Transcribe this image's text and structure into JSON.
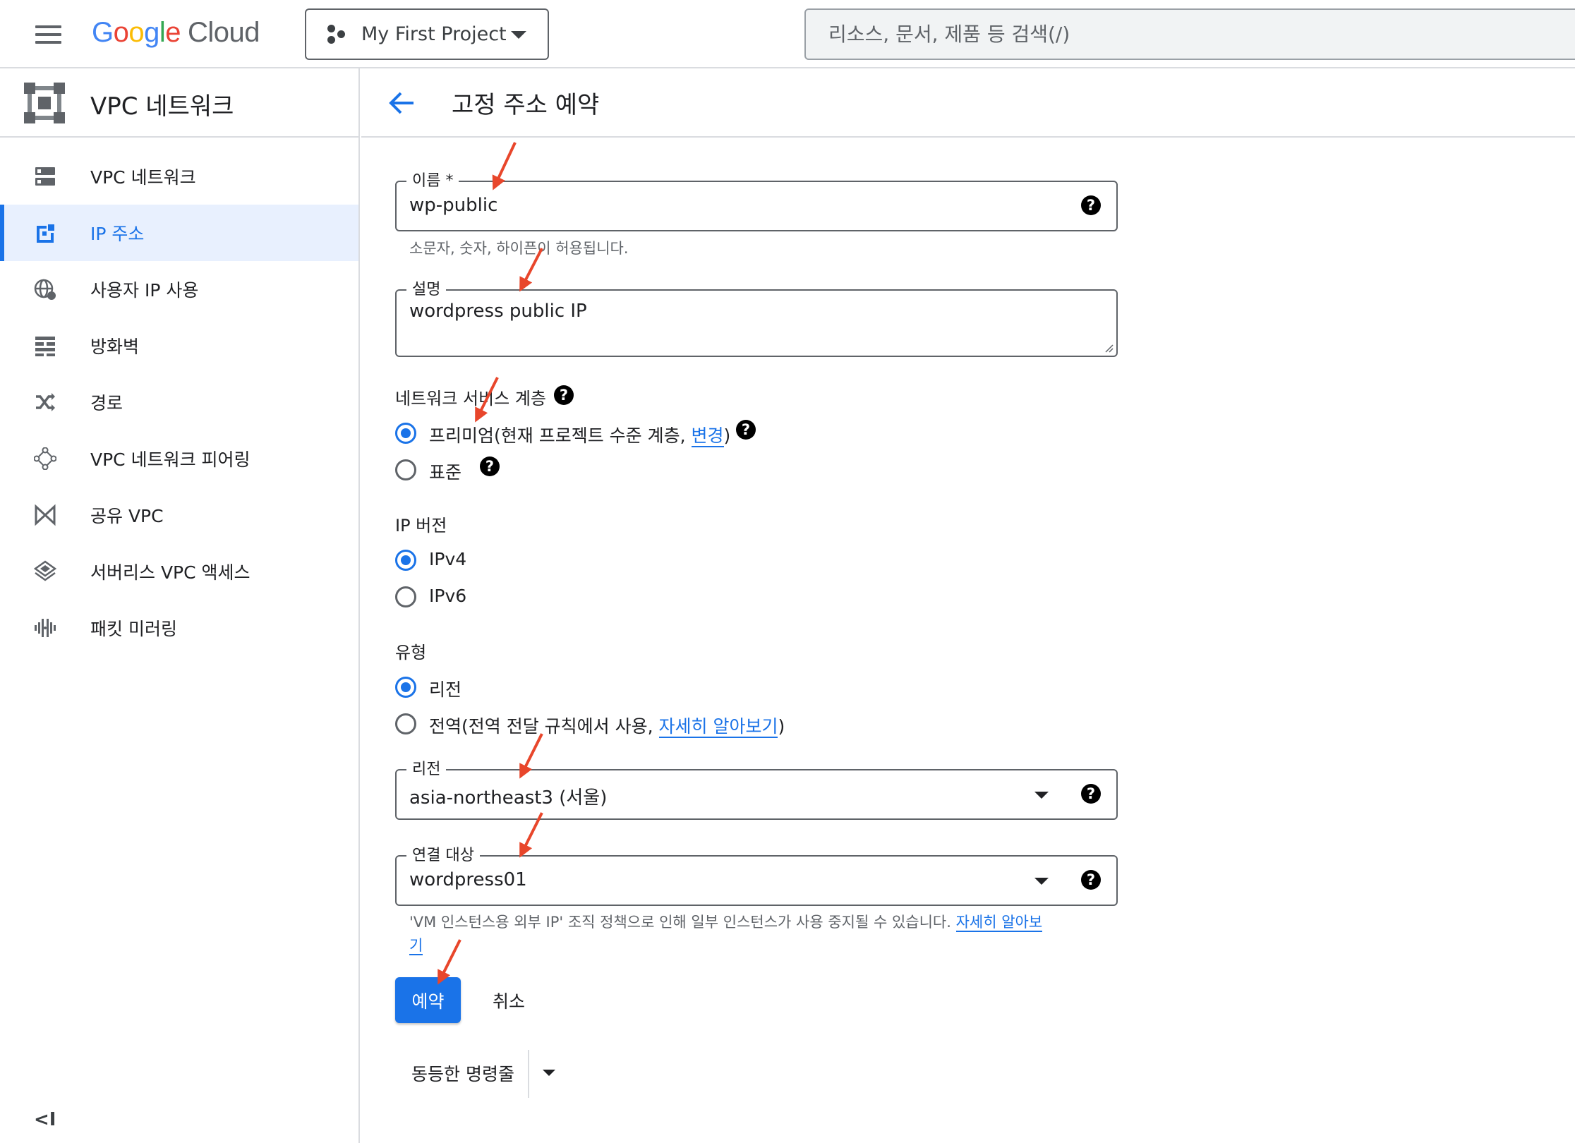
{
  "topbar": {
    "logo_letters": [
      "G",
      "o",
      "o",
      "g",
      "l",
      "e"
    ],
    "logo_cloud": "Cloud",
    "project": "My First Project",
    "search_placeholder": "리소스, 문서, 제품 등 검색(/)"
  },
  "sidebar": {
    "title": "VPC 네트워크",
    "items": [
      {
        "label": "VPC 네트워크",
        "icon": "vpc-networks-icon"
      },
      {
        "label": "IP 주소",
        "icon": "ip-address-icon",
        "active": true
      },
      {
        "label": "사용자 IP 사용",
        "icon": "globe-icon"
      },
      {
        "label": "방화벽",
        "icon": "firewall-icon"
      },
      {
        "label": "경로",
        "icon": "routes-icon"
      },
      {
        "label": "VPC 네트워크 피어링",
        "icon": "peering-icon"
      },
      {
        "label": "공유 VPC",
        "icon": "shared-vpc-icon"
      },
      {
        "label": "서버리스 VPC 액세스",
        "icon": "serverless-icon"
      },
      {
        "label": "패킷 미러링",
        "icon": "packet-mirroring-icon"
      }
    ],
    "collapse_label": "<I"
  },
  "page": {
    "title": "고정 주소 예약"
  },
  "form": {
    "name": {
      "label": "이름 *",
      "value": "wp-public",
      "hint": "소문자, 숫자, 하이픈이 허용됩니다."
    },
    "description": {
      "label": "설명",
      "value": "wordpress public IP"
    },
    "network_tier": {
      "label": "네트워크 서비스 계층",
      "premium_label": "프리미엄(현재 프로젝트 수준 계층, ",
      "premium_link": "변경",
      "premium_close": ")",
      "standard_label": "표준",
      "selected": "premium"
    },
    "ip_version": {
      "label": "IP 버전",
      "options": [
        "IPv4",
        "IPv6"
      ],
      "selected": "IPv4"
    },
    "type": {
      "label": "유형",
      "regional_label": "리전",
      "global_label": "전역(전역 전달 규칙에서 사용, ",
      "global_link": "자세히 알아보기",
      "global_close": ")",
      "selected": "regional"
    },
    "region": {
      "label": "리전",
      "value": "asia-northeast3 (서울)"
    },
    "attached_to": {
      "label": "연결 대상",
      "value": "wordpress01",
      "hint": "'VM 인스턴스용 외부 IP' 조직 정책으로 인해 일부 인스턴스가 사용 중지될 수 있습니다. ",
      "hint_link_1": "자세히 알아보",
      "hint_link_2": "기"
    }
  },
  "actions": {
    "reserve": "예약",
    "cancel": "취소",
    "equivalent_command": "동등한 명령줄"
  },
  "help_glyph": "?",
  "colors": {
    "accent": "#1a73e8",
    "annotation_arrow": "#e8462b"
  }
}
